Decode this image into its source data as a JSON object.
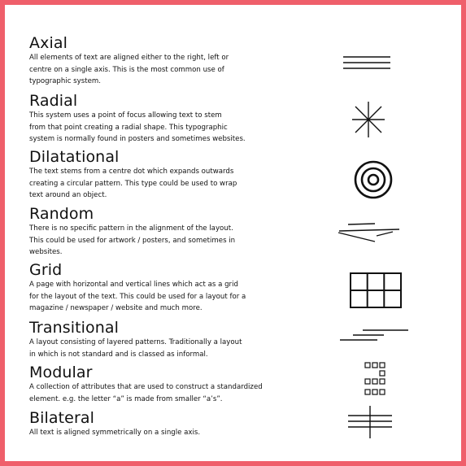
{
  "sections": [
    {
      "title": "Axial",
      "text": "All elements of text are aligned either to the right, left or\ncentre on a single axis. This is the most common use of\ntypographic system.",
      "icon": "three-horizontal-lines-icon"
    },
    {
      "title": "Radial",
      "text": "This system uses a point of focus allowing text to stem\nfrom that point creating a radial shape. This typographic\nsystem is normally found in posters and sometimes websites.",
      "icon": "asterisk-star-icon"
    },
    {
      "title": "Dilatational",
      "text": "The text stems from a centre dot which expands outwards\ncreating a circular pattern. This type could be used to wrap\ntext around an object.",
      "icon": "concentric-circles-icon"
    },
    {
      "title": "Random",
      "text": "There is no specific pattern in the alignment of the layout.\nThis could be used for artwork / posters, and sometimes in\nwebsites.",
      "icon": "scattered-lines-icon"
    },
    {
      "title": "Grid",
      "text": "A page with horizontal and vertical lines which act as a grid\nfor the layout of the text. This could be used for a layout for a\nmagazine / newspaper / website and much more.",
      "icon": "grid-icon"
    },
    {
      "title": "Transitional",
      "text": "A layout consisting of layered patterns. Traditionally a layout\nin which is not standard and is classed as informal.",
      "icon": "layered-lines-icon"
    },
    {
      "title": "Modular",
      "text": "A collection of attributes that are used to construct a standardized\nelement. e.g. the letter “a” is made from smaller “a’s”.",
      "icon": "modular-squares-icon"
    },
    {
      "title": "Bilateral",
      "text": "All text is aligned symmetrically on a single axis.",
      "icon": "bilateral-axis-icon"
    }
  ],
  "colors": {
    "border": "#ef5f6b",
    "text": "#111111",
    "background": "#ffffff"
  }
}
